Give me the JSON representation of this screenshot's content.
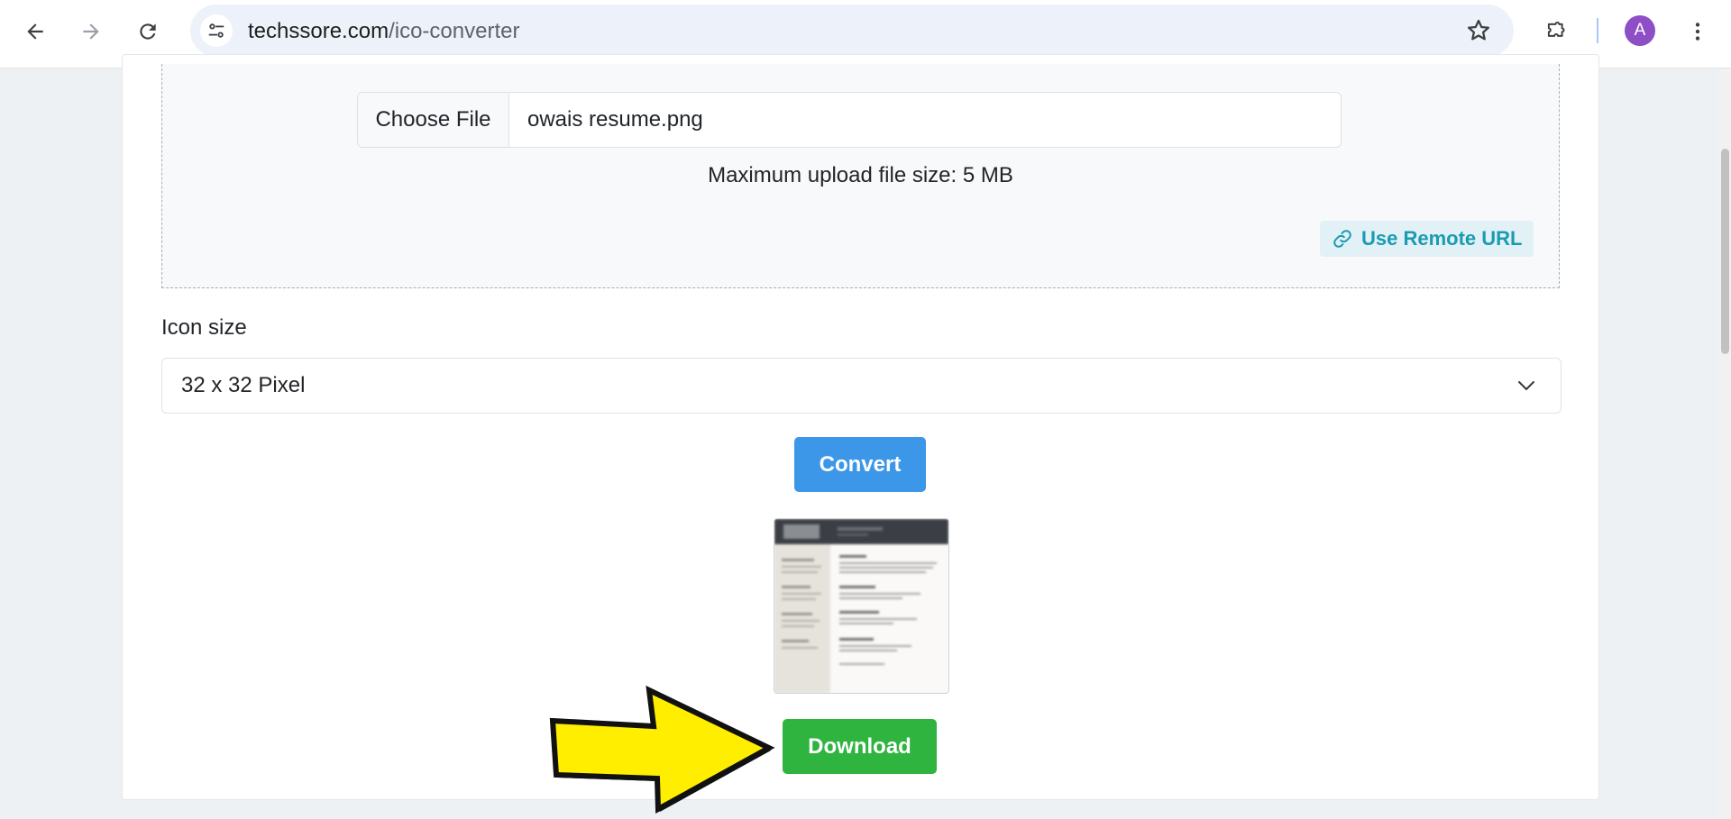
{
  "browser": {
    "url_host": "techssore.com",
    "url_path": "/ico-converter",
    "avatar_letter": "A",
    "icons": {
      "back": "arrow-left-icon",
      "forward": "arrow-right-icon",
      "reload": "reload-icon",
      "site_info": "tune-icon",
      "bookmark": "star-icon",
      "extensions": "puzzle-icon",
      "menu": "kebab-menu-icon"
    }
  },
  "upload": {
    "choose_file_label": "Choose File",
    "file_name": "owais resume.png",
    "max_size_text": "Maximum upload file size: 5 MB",
    "remote_url_label": "Use Remote URL"
  },
  "options": {
    "icon_size_label": "Icon size",
    "icon_size_value": "32 x 32 Pixel"
  },
  "actions": {
    "convert_label": "Convert",
    "download_label": "Download"
  },
  "colors": {
    "convert": "#3d97e8",
    "download": "#2eb43f",
    "remote_url_text": "#1a9bb2",
    "arrow_fill": "#ffee00",
    "avatar": "#8e4ec6"
  }
}
